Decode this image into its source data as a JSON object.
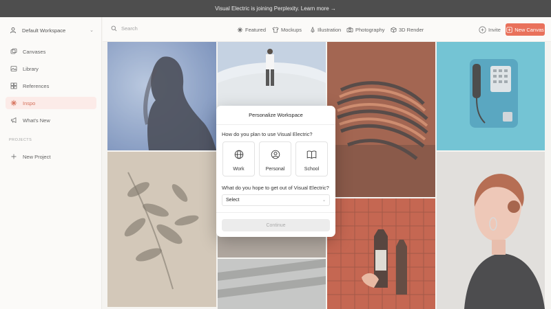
{
  "banner": {
    "text": "Visual Electric is joining Perplexity. Learn more →"
  },
  "sidebar": {
    "workspace": {
      "label": "Default Workspace",
      "icon": "person-icon"
    },
    "items": [
      {
        "label": "Canvases",
        "icon": "canvases-icon"
      },
      {
        "label": "Library",
        "icon": "library-icon"
      },
      {
        "label": "References",
        "icon": "references-icon"
      },
      {
        "label": "Inspo",
        "icon": "sparkle-icon",
        "active": true
      },
      {
        "label": "What's New",
        "icon": "megaphone-icon"
      }
    ],
    "projects_label": "PROJECTS",
    "new_project": "New Project"
  },
  "topbar": {
    "search_placeholder": "Search",
    "categories": [
      {
        "label": "Featured",
        "icon": "sparkle-icon"
      },
      {
        "label": "Mockups",
        "icon": "tshirt-icon"
      },
      {
        "label": "Illustration",
        "icon": "pen-nib-icon"
      },
      {
        "label": "Photography",
        "icon": "camera-icon"
      },
      {
        "label": "3D Render",
        "icon": "cube-icon"
      }
    ],
    "invite": "Invite",
    "new_canvas": "New Canvas"
  },
  "modal": {
    "title": "Personalize Workspace",
    "question1": "How do you plan to use Visual Electric?",
    "options": [
      {
        "label": "Work",
        "icon": "globe-icon"
      },
      {
        "label": "Personal",
        "icon": "user-circle-icon"
      },
      {
        "label": "School",
        "icon": "book-icon"
      }
    ],
    "question2": "What do you hope to get out of Visual Electric?",
    "select_value": "Select",
    "continue": "Continue"
  },
  "colors": {
    "accent": "#e34a2d",
    "active_bg": "#fbe6e2",
    "banner_bg": "#1d1d1d"
  }
}
